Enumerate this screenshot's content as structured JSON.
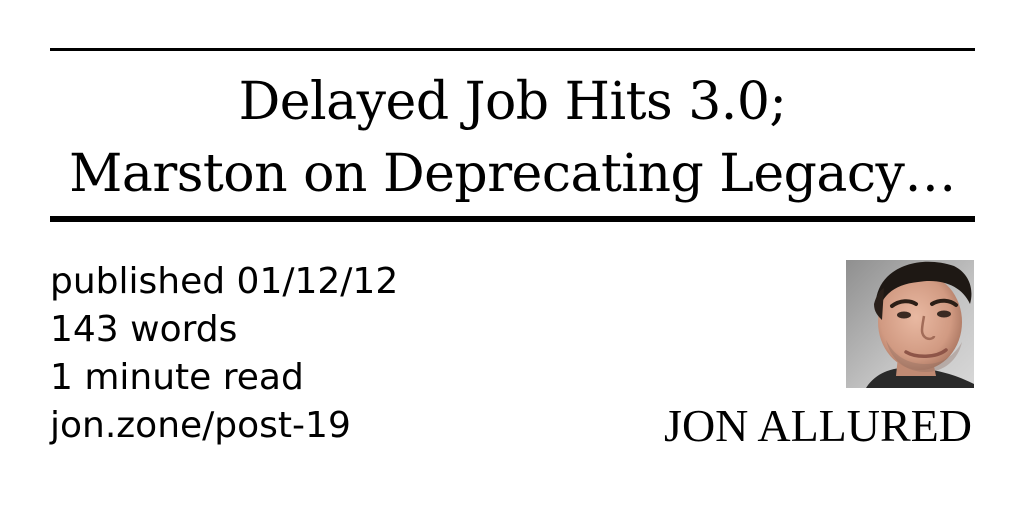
{
  "title": {
    "line1": "Delayed Job Hits 3.0;",
    "line2": "Marston on Deprecating Legacy…"
  },
  "meta": {
    "published": "published 01/12/12",
    "words": "143 words",
    "read_time": "1 minute read",
    "url": "jon.zone/post-19"
  },
  "author": {
    "name": "JON ALLURED"
  }
}
